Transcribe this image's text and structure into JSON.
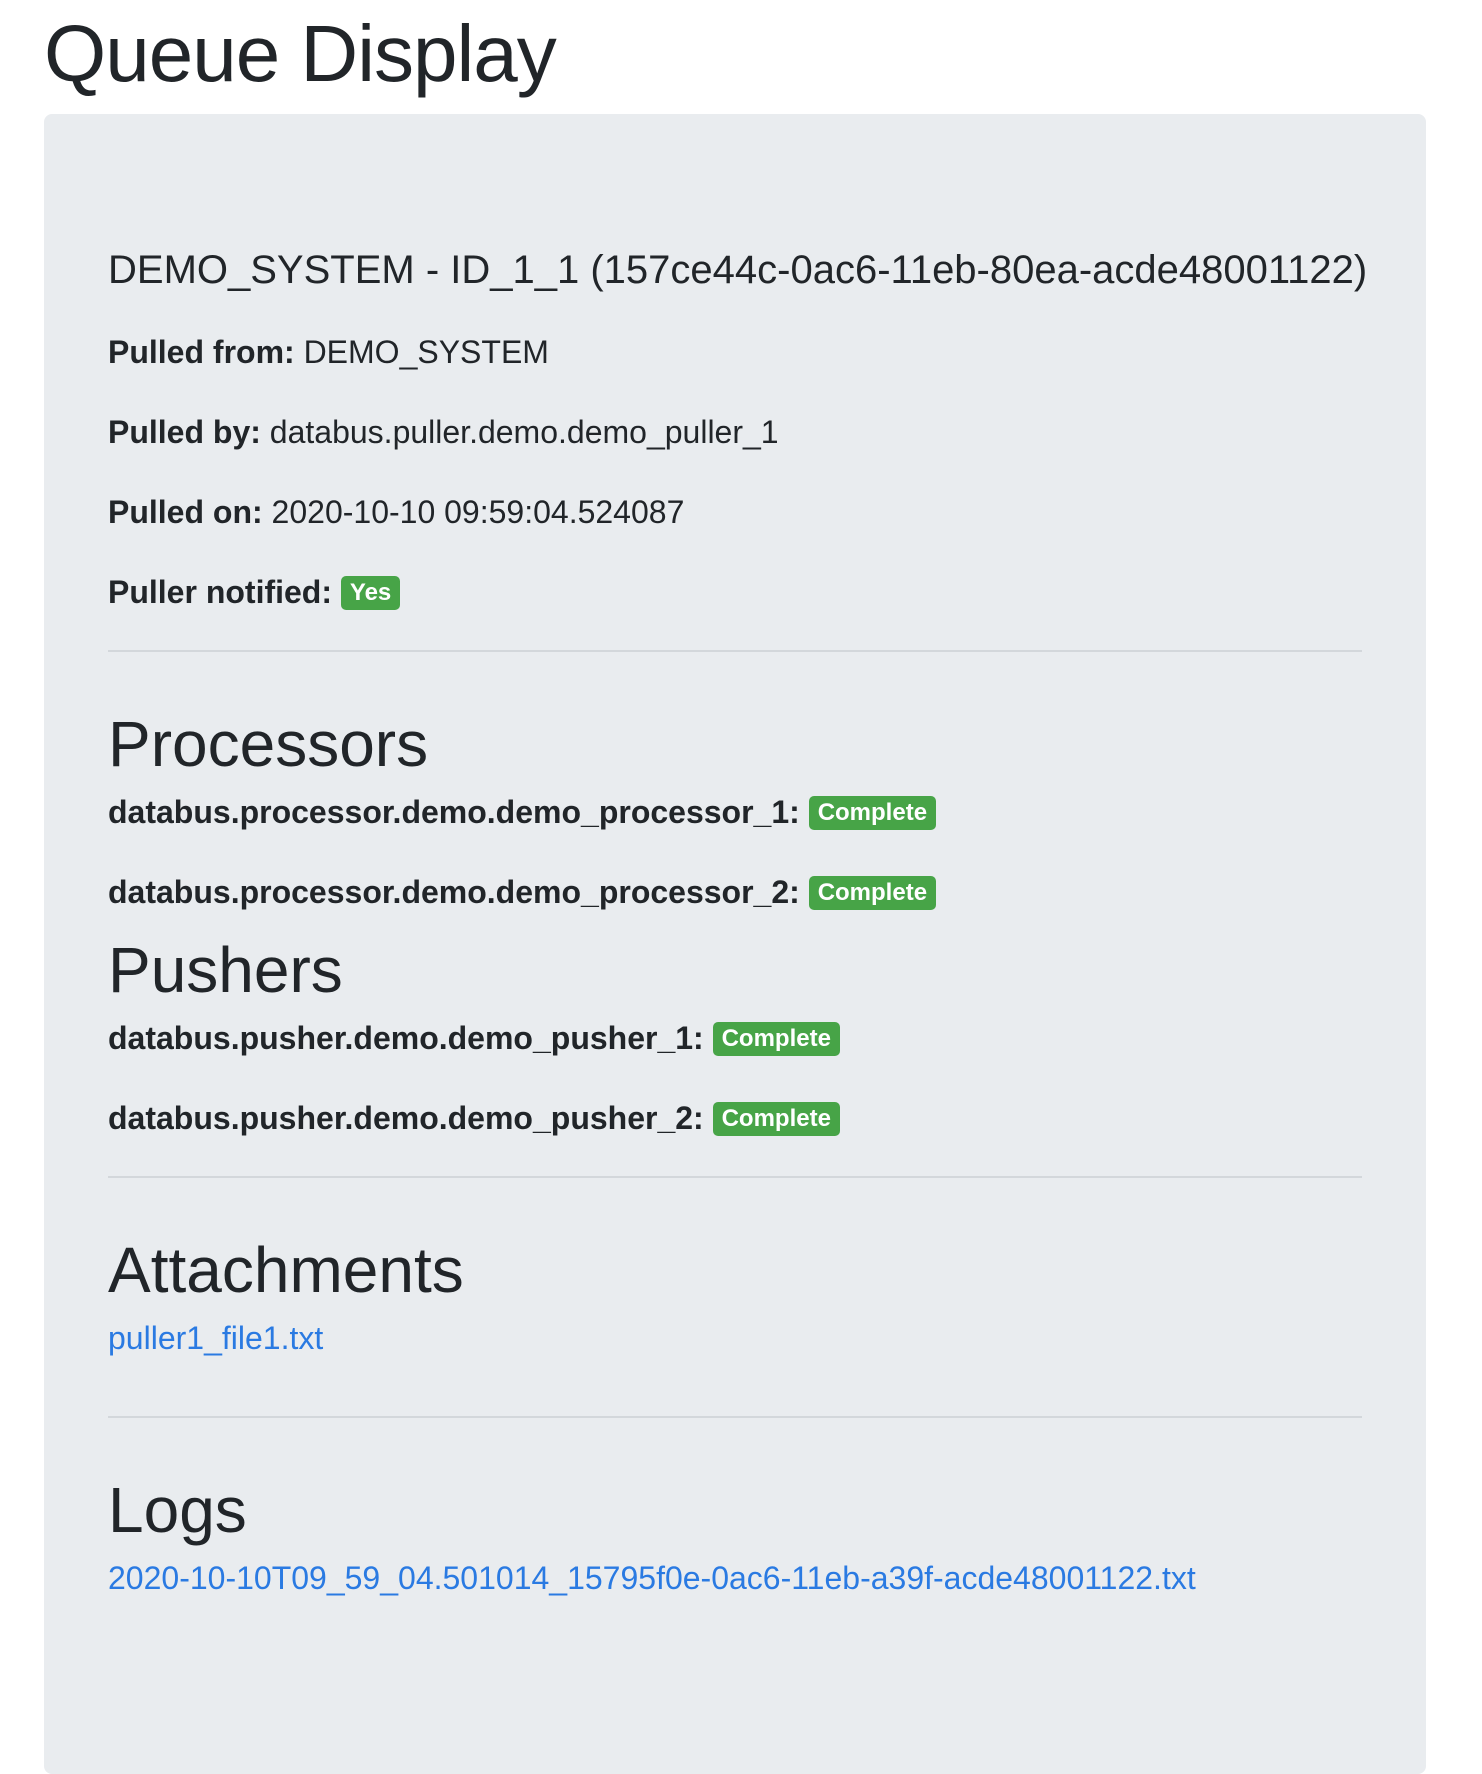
{
  "page": {
    "title": "Queue Display"
  },
  "record": {
    "title": "DEMO_SYSTEM - ID_1_1 (157ce44c-0ac6-11eb-80ea-acde48001122)",
    "fields": [
      {
        "label": "Pulled from:",
        "value": "DEMO_SYSTEM"
      },
      {
        "label": "Pulled by:",
        "value": "databus.puller.demo.demo_puller_1"
      },
      {
        "label": "Pulled on:",
        "value": "2020-10-10 09:59:04.524087"
      }
    ],
    "notified": {
      "label": "Puller notified:",
      "badge": "Yes"
    }
  },
  "processors": {
    "title": "Processors",
    "items": [
      {
        "name": "databus.processor.demo.demo_processor_1:",
        "status": "Complete"
      },
      {
        "name": "databus.processor.demo.demo_processor_2:",
        "status": "Complete"
      }
    ]
  },
  "pushers": {
    "title": "Pushers",
    "items": [
      {
        "name": "databus.pusher.demo.demo_pusher_1:",
        "status": "Complete"
      },
      {
        "name": "databus.pusher.demo.demo_pusher_2:",
        "status": "Complete"
      }
    ]
  },
  "attachments": {
    "title": "Attachments",
    "items": [
      "puller1_file1.txt"
    ]
  },
  "logs": {
    "title": "Logs",
    "items": [
      "2020-10-10T09_59_04.501014_15795f0e-0ac6-11eb-a39f-acde48001122.txt"
    ]
  },
  "colors": {
    "badge_success": "#47a447",
    "link": "#2a7ae2",
    "panel_background": "#e9ecef"
  }
}
